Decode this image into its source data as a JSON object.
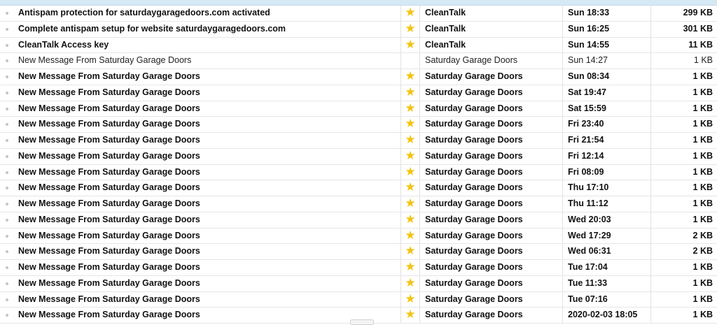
{
  "colors": {
    "star": "#f1c40f",
    "header_strip": "#d5e9f5",
    "row_divider": "#e6e6e6",
    "unread_dot": "#c4c4c4"
  },
  "icons": {
    "flag": "star-icon",
    "status": "unread-dot-icon"
  },
  "messages": [
    {
      "subject": "Antispam protection for saturdaygaragedoors.com activated",
      "sender": "CleanTalk",
      "date": "Sun 18:33",
      "size": "299 KB",
      "starred": true,
      "unread": true
    },
    {
      "subject": "Complete antispam setup for website saturdaygaragedoors.com",
      "sender": "CleanTalk",
      "date": "Sun 16:25",
      "size": "301 KB",
      "starred": true,
      "unread": true
    },
    {
      "subject": "CleanTalk Access key",
      "sender": "CleanTalk",
      "date": "Sun 14:55",
      "size": "11 KB",
      "starred": true,
      "unread": true
    },
    {
      "subject": "New Message From Saturday Garage Doors",
      "sender": "Saturday Garage Doors",
      "date": "Sun 14:27",
      "size": "1 KB",
      "starred": false,
      "unread": false
    },
    {
      "subject": "New Message From Saturday Garage Doors",
      "sender": "Saturday Garage Doors",
      "date": "Sun 08:34",
      "size": "1 KB",
      "starred": true,
      "unread": true
    },
    {
      "subject": "New Message From Saturday Garage Doors",
      "sender": "Saturday Garage Doors",
      "date": "Sat 19:47",
      "size": "1 KB",
      "starred": true,
      "unread": true
    },
    {
      "subject": "New Message From Saturday Garage Doors",
      "sender": "Saturday Garage Doors",
      "date": "Sat 15:59",
      "size": "1 KB",
      "starred": true,
      "unread": true
    },
    {
      "subject": "New Message From Saturday Garage Doors",
      "sender": "Saturday Garage Doors",
      "date": "Fri 23:40",
      "size": "1 KB",
      "starred": true,
      "unread": true
    },
    {
      "subject": "New Message From Saturday Garage Doors",
      "sender": "Saturday Garage Doors",
      "date": "Fri 21:54",
      "size": "1 KB",
      "starred": true,
      "unread": true
    },
    {
      "subject": "New Message From Saturday Garage Doors",
      "sender": "Saturday Garage Doors",
      "date": "Fri 12:14",
      "size": "1 KB",
      "starred": true,
      "unread": true
    },
    {
      "subject": "New Message From Saturday Garage Doors",
      "sender": "Saturday Garage Doors",
      "date": "Fri 08:09",
      "size": "1 KB",
      "starred": true,
      "unread": true
    },
    {
      "subject": "New Message From Saturday Garage Doors",
      "sender": "Saturday Garage Doors",
      "date": "Thu 17:10",
      "size": "1 KB",
      "starred": true,
      "unread": true
    },
    {
      "subject": "New Message From Saturday Garage Doors",
      "sender": "Saturday Garage Doors",
      "date": "Thu 11:12",
      "size": "1 KB",
      "starred": true,
      "unread": true
    },
    {
      "subject": "New Message From Saturday Garage Doors",
      "sender": "Saturday Garage Doors",
      "date": "Wed 20:03",
      "size": "1 KB",
      "starred": true,
      "unread": true
    },
    {
      "subject": "New Message From Saturday Garage Doors",
      "sender": "Saturday Garage Doors",
      "date": "Wed 17:29",
      "size": "2 KB",
      "starred": true,
      "unread": true
    },
    {
      "subject": "New Message From Saturday Garage Doors",
      "sender": "Saturday Garage Doors",
      "date": "Wed 06:31",
      "size": "2 KB",
      "starred": true,
      "unread": true
    },
    {
      "subject": "New Message From Saturday Garage Doors",
      "sender": "Saturday Garage Doors",
      "date": "Tue 17:04",
      "size": "1 KB",
      "starred": true,
      "unread": true
    },
    {
      "subject": "New Message From Saturday Garage Doors",
      "sender": "Saturday Garage Doors",
      "date": "Tue 11:33",
      "size": "1 KB",
      "starred": true,
      "unread": true
    },
    {
      "subject": "New Message From Saturday Garage Doors",
      "sender": "Saturday Garage Doors",
      "date": "Tue 07:16",
      "size": "1 KB",
      "starred": true,
      "unread": true
    },
    {
      "subject": "New Message From Saturday Garage Doors",
      "sender": "Saturday Garage Doors",
      "date": "2020-02-03 18:05",
      "size": "1 KB",
      "starred": true,
      "unread": true
    }
  ]
}
